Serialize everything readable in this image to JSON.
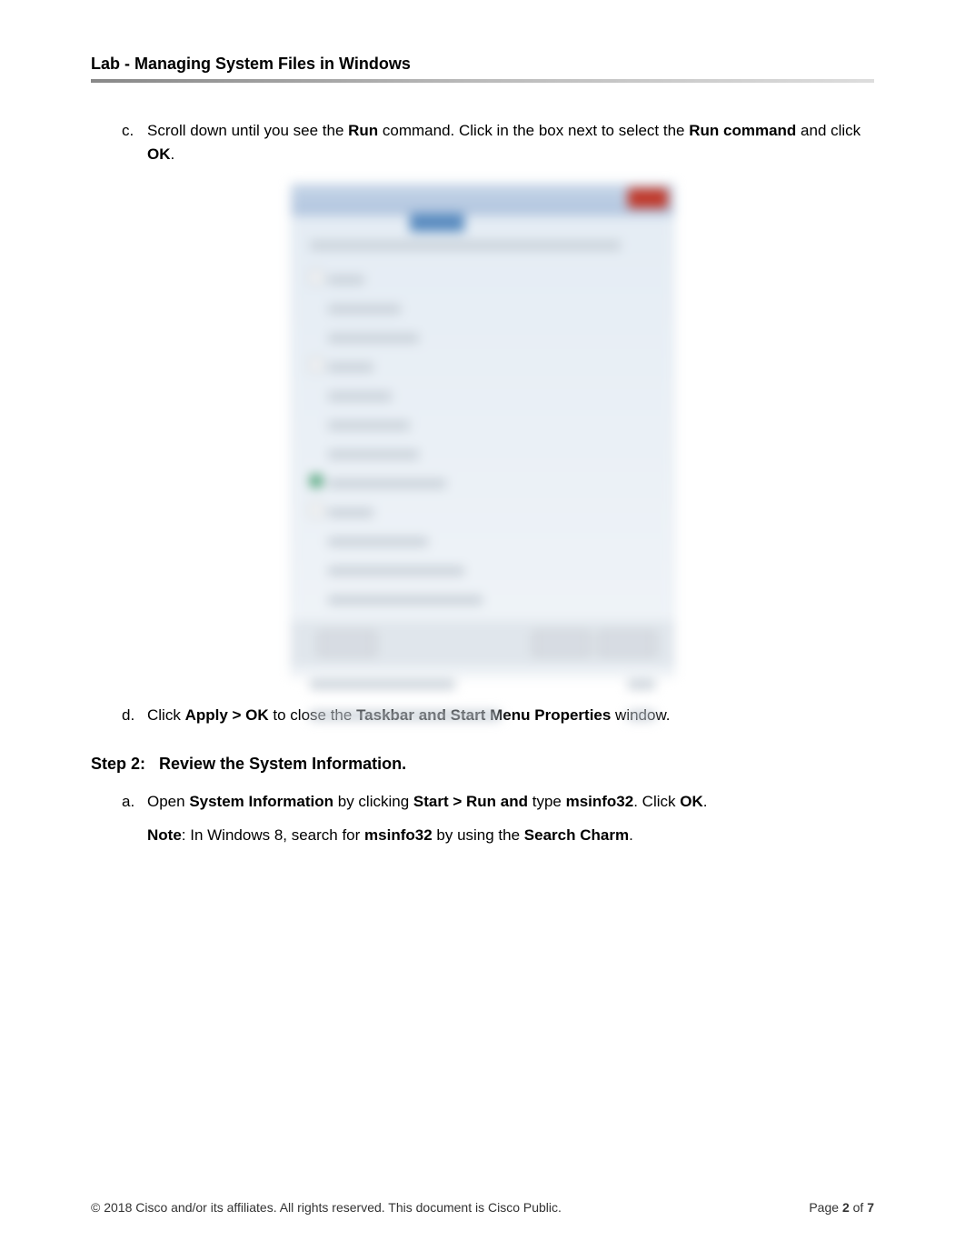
{
  "header": {
    "title": "Lab - Managing System Files in Windows"
  },
  "item_c": {
    "marker": "c.",
    "text_1": "Scroll down until you see the ",
    "bold_1": "Run",
    "text_2": " command. Click in the box next to select the ",
    "bold_2": "Run command ",
    "text_3": "and click ",
    "bold_3": "OK",
    "text_4": "."
  },
  "item_d": {
    "marker": "d.",
    "text_1": "Click ",
    "bold_1": "Apply > OK ",
    "text_2": "to close the ",
    "bold_2": "Taskbar and Start Menu Properties",
    "text_3": " window."
  },
  "step2": {
    "label": "Step 2:",
    "title": "Review the System Information."
  },
  "item_a": {
    "marker": "a.",
    "text_1": "Open ",
    "bold_1": "System Information",
    "text_2": " by clicking ",
    "bold_2": "Start > Run and ",
    "text_3": "type ",
    "bold_3": "msinfo32",
    "text_4": ". Click ",
    "bold_4": "OK",
    "text_5": "."
  },
  "note": {
    "bold_1": "Note",
    "text_1": ": In Windows 8, search for ",
    "bold_2": "msinfo32",
    "text_2": " by using the ",
    "bold_3": "Search Charm",
    "text_3": "."
  },
  "footer": {
    "copyright": "© 2018 Cisco and/or its affiliates. All rights reserved. This document is Cisco Public.",
    "page_prefix": "Page ",
    "page_num": "2",
    "page_of": " of ",
    "page_total": "7"
  }
}
